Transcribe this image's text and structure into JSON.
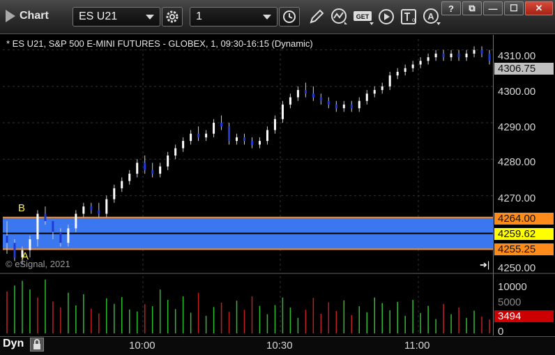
{
  "app": {
    "title": "Chart"
  },
  "toolbar": {
    "symbol": "ES U21",
    "interval": "1",
    "icons": [
      "settings-icon",
      "clock-icon",
      "pencil-icon",
      "study-icon",
      "get-icon",
      "play-icon",
      "text-icon",
      "alert-icon"
    ]
  },
  "window_buttons": {
    "help": "?",
    "restore": "⧉",
    "minimize": "—",
    "maximize": "☐",
    "close": "✕"
  },
  "chart": {
    "header": "* ES U21, S&P 500 E-MINI FUTURES - GLOBEX, 1, 09:30-16:15 (Dynamic)",
    "copyright": "© eSignal, 2021",
    "price_ticks": [
      "4310.00",
      "4300.00",
      "4290.00",
      "4280.00",
      "4270.00",
      "4250.00"
    ],
    "last_price": "4306.75",
    "level_upper": "4264.00",
    "level_mid": "4259.62",
    "level_lower": "4255.25",
    "label_a": "A",
    "label_b": "B",
    "volume_ticks": [
      "10000",
      "5000",
      "0"
    ],
    "last_volume": "3494",
    "time_ticks": [
      "10:00",
      "10:30",
      "11:00"
    ],
    "mode_label": "Dyn"
  },
  "colors": {
    "up": "#ffffff",
    "down": "#1f3bd6",
    "band": "#3b78f0",
    "level_line": "#ff8c1a",
    "mid_tag": "#ffff00",
    "volume_up": "#2fbf2f",
    "volume_down": "#c42020",
    "last_volume_bg": "#cc0000",
    "last_price_bg": "#c0c0c0"
  },
  "chart_data": {
    "type": "candlestick",
    "price_range": [
      4249,
      4313
    ],
    "candles": [
      [
        4259,
        4263,
        4254,
        4257
      ],
      [
        4257,
        4258,
        4252,
        4253
      ],
      [
        4253,
        4256,
        4251,
        4255
      ],
      [
        4255,
        4259,
        4253,
        4258
      ],
      [
        4258,
        4266,
        4256,
        4265
      ],
      [
        4265,
        4267,
        4262,
        4263
      ],
      [
        4263,
        4262,
        4258,
        4260
      ],
      [
        4260,
        4261,
        4256,
        4257
      ],
      [
        4257,
        4262,
        4256,
        4261
      ],
      [
        4261,
        4266,
        4260,
        4265
      ],
      [
        4265,
        4268,
        4264,
        4267
      ],
      [
        4267,
        4268,
        4265,
        4266
      ],
      [
        4266,
        4268,
        4264,
        4265
      ],
      [
        4265,
        4270,
        4264,
        4269
      ],
      [
        4269,
        4273,
        4268,
        4272
      ],
      [
        4272,
        4275,
        4271,
        4274
      ],
      [
        4274,
        4277,
        4273,
        4276
      ],
      [
        4276,
        4280,
        4275,
        4279
      ],
      [
        4279,
        4281,
        4276,
        4277
      ],
      [
        4277,
        4279,
        4275,
        4276
      ],
      [
        4276,
        4279,
        4275,
        4278
      ],
      [
        4278,
        4282,
        4277,
        4281
      ],
      [
        4281,
        4284,
        4280,
        4283
      ],
      [
        4283,
        4286,
        4282,
        4285
      ],
      [
        4285,
        4288,
        4284,
        4287
      ],
      [
        4287,
        4289,
        4285,
        4286
      ],
      [
        4286,
        4288,
        4285,
        4287
      ],
      [
        4287,
        4291,
        4286,
        4290
      ],
      [
        4290,
        4292,
        4288,
        4289
      ],
      [
        4289,
        4290,
        4284,
        4285
      ],
      [
        4285,
        4287,
        4284,
        4286
      ],
      [
        4286,
        4287,
        4284,
        4285
      ],
      [
        4285,
        4286,
        4283,
        4284
      ],
      [
        4284,
        4286,
        4283,
        4285
      ],
      [
        4285,
        4289,
        4284,
        4288
      ],
      [
        4288,
        4292,
        4287,
        4291
      ],
      [
        4291,
        4296,
        4290,
        4295
      ],
      [
        4295,
        4298,
        4294,
        4297
      ],
      [
        4297,
        4300,
        4296,
        4299
      ],
      [
        4299,
        4301,
        4297,
        4298
      ],
      [
        4298,
        4300,
        4296,
        4297
      ],
      [
        4297,
        4298,
        4295,
        4296
      ],
      [
        4296,
        4297,
        4294,
        4295
      ],
      [
        4295,
        4296,
        4293,
        4294
      ],
      [
        4294,
        4296,
        4293,
        4295
      ],
      [
        4295,
        4296,
        4293,
        4294
      ],
      [
        4294,
        4297,
        4293,
        4296
      ],
      [
        4296,
        4299,
        4295,
        4298
      ],
      [
        4298,
        4300,
        4297,
        4299
      ],
      [
        4299,
        4301,
        4298,
        4300
      ],
      [
        4300,
        4304,
        4299,
        4303
      ],
      [
        4303,
        4305,
        4302,
        4304
      ],
      [
        4304,
        4306,
        4303,
        4305
      ],
      [
        4305,
        4307,
        4304,
        4306
      ],
      [
        4306,
        4308,
        4305,
        4307
      ],
      [
        4307,
        4309,
        4306,
        4308
      ],
      [
        4308,
        4310,
        4307,
        4309
      ],
      [
        4309,
        4310,
        4307,
        4308
      ],
      [
        4308,
        4310,
        4307,
        4309
      ],
      [
        4309,
        4310,
        4307,
        4308
      ],
      [
        4308,
        4310,
        4307,
        4309
      ],
      [
        4309,
        4311,
        4308,
        4310
      ],
      [
        4310,
        4311,
        4308,
        4309
      ],
      [
        4309,
        4310,
        4306,
        4307
      ]
    ],
    "volume_range": [
      0,
      14000
    ],
    "volumes": [
      10500,
      12000,
      13200,
      11000,
      9000,
      13500,
      8000,
      6500,
      10200,
      7000,
      9800,
      6200,
      5000,
      8800,
      7400,
      9100,
      6000,
      5500,
      7300,
      6800,
      11000,
      8400,
      6100,
      9300,
      5200,
      10200,
      4400,
      6600,
      7700,
      5400,
      8200,
      5900,
      9300,
      6900,
      4800,
      7100,
      9000,
      6500,
      3900,
      5900,
      8900,
      4900,
      7800,
      5600,
      8300,
      4600,
      6800,
      5300,
      9000,
      7600,
      5800,
      7900,
      4400,
      8400,
      5100,
      6900,
      3600,
      7400,
      4800,
      6500,
      3900,
      5700,
      4200,
      3494
    ],
    "volume_up": [
      0,
      1,
      1,
      1,
      0,
      1,
      0,
      0,
      1,
      1,
      1,
      0,
      0,
      1,
      1,
      1,
      1,
      1,
      0,
      1,
      1,
      1,
      1,
      1,
      1,
      0,
      1,
      1,
      0,
      0,
      1,
      0,
      0,
      1,
      1,
      1,
      1,
      1,
      1,
      0,
      0,
      0,
      0,
      0,
      1,
      0,
      1,
      1,
      1,
      1,
      1,
      1,
      1,
      1,
      1,
      1,
      1,
      0,
      1,
      0,
      1,
      1,
      0,
      0
    ],
    "time_ticks": [
      "10:00",
      "10:30",
      "11:00"
    ],
    "levels": {
      "upper": 4264.0,
      "mid": 4259.62,
      "lower": 4255.25
    }
  }
}
